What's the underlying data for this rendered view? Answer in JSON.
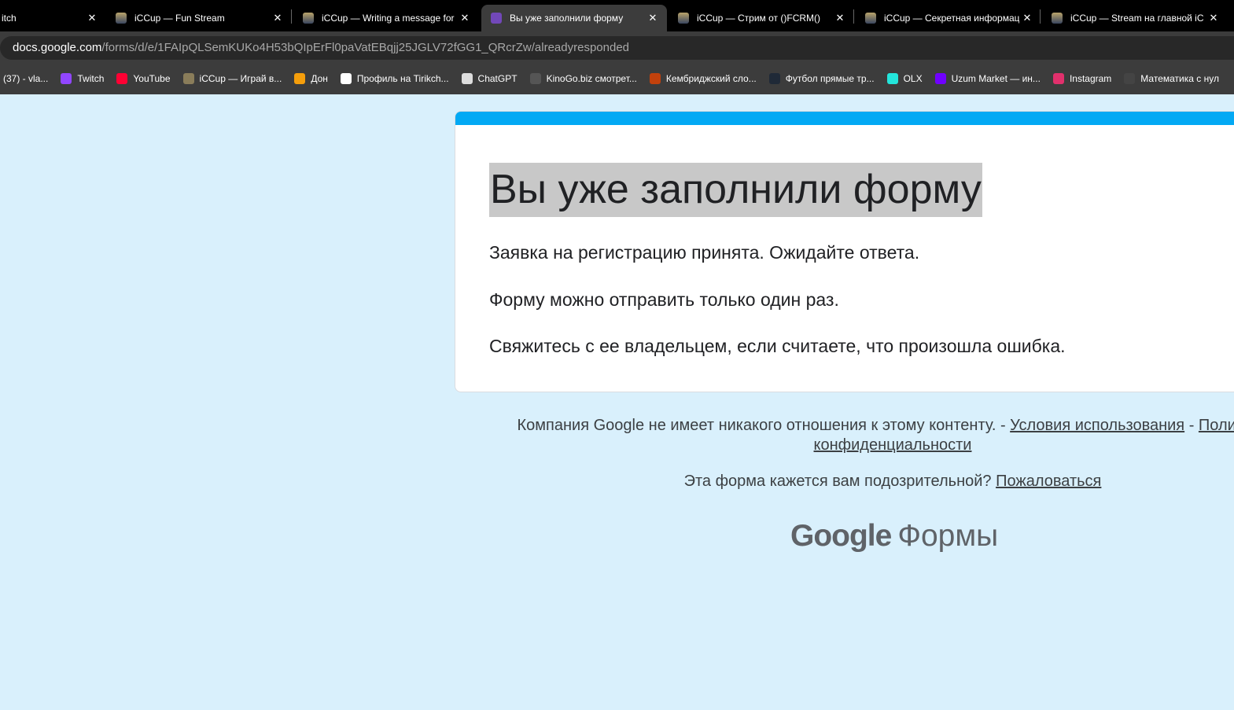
{
  "tabs": [
    {
      "title": "itch",
      "active": false
    },
    {
      "title": "iCCup — Fun Stream",
      "active": false
    },
    {
      "title": "iCCup — Writing a message for",
      "active": false
    },
    {
      "title": "Вы уже заполнили форму",
      "active": true
    },
    {
      "title": "iCCup — Стрим от ()FCRM()",
      "active": false
    },
    {
      "title": "iCCup — Секретная информац",
      "active": false
    },
    {
      "title": "iCCup — Stream на главной iC",
      "active": false
    }
  ],
  "close_glyph": "✕",
  "url": {
    "host": "docs.google.com",
    "path": "/forms/d/e/1FAIpQLSemKUKo4H53bQIpErFl0paVatEBqjj25JGLV72fGG1_QRcrZw/alreadyresponded"
  },
  "bookmarks": [
    {
      "label": "(37) - vla...",
      "color": ""
    },
    {
      "label": "Twitch",
      "color": "#9146ff"
    },
    {
      "label": "YouTube",
      "color": "#ff0033"
    },
    {
      "label": "iCCup — Играй в...",
      "color": "#8a7d5a"
    },
    {
      "label": "Дон",
      "color": "#f59e0b"
    },
    {
      "label": "Профиль на Tirikch...",
      "color": "#ffffff"
    },
    {
      "label": "ChatGPT",
      "color": "#dddddd"
    },
    {
      "label": "KinoGo.biz смотрет...",
      "color": "#555555"
    },
    {
      "label": "Кембриджский сло...",
      "color": "#c2410c"
    },
    {
      "label": "Футбол прямые тр...",
      "color": "#1f2937"
    },
    {
      "label": "OLX",
      "color": "#23e5db"
    },
    {
      "label": "Uzum Market — ин...",
      "color": "#7000ff"
    },
    {
      "label": "Instagram",
      "color": "#e1306c"
    },
    {
      "label": "Математика с нул",
      "color": "#444444"
    }
  ],
  "form": {
    "accent": "#03a9f4",
    "title": "Вы уже заполнили форму",
    "messages": [
      "Заявка на регистрацию принята. Ожидайте ответа.",
      "Форму можно отправить только один раз.",
      "Свяжитесь с ее владельцем, если считаете, что произошла ошибка."
    ]
  },
  "footer": {
    "disclaimer": "Компания Google не имеет никакого отношения к этому контенту. - ",
    "terms": "Условия использования",
    "dash": " - ",
    "privacy": "Политика конфиденциальности",
    "suspicious": "Эта форма кажется вам подозрительной? ",
    "report": "Пожаловаться",
    "logo_google": "Google",
    "logo_forms": "Формы"
  }
}
